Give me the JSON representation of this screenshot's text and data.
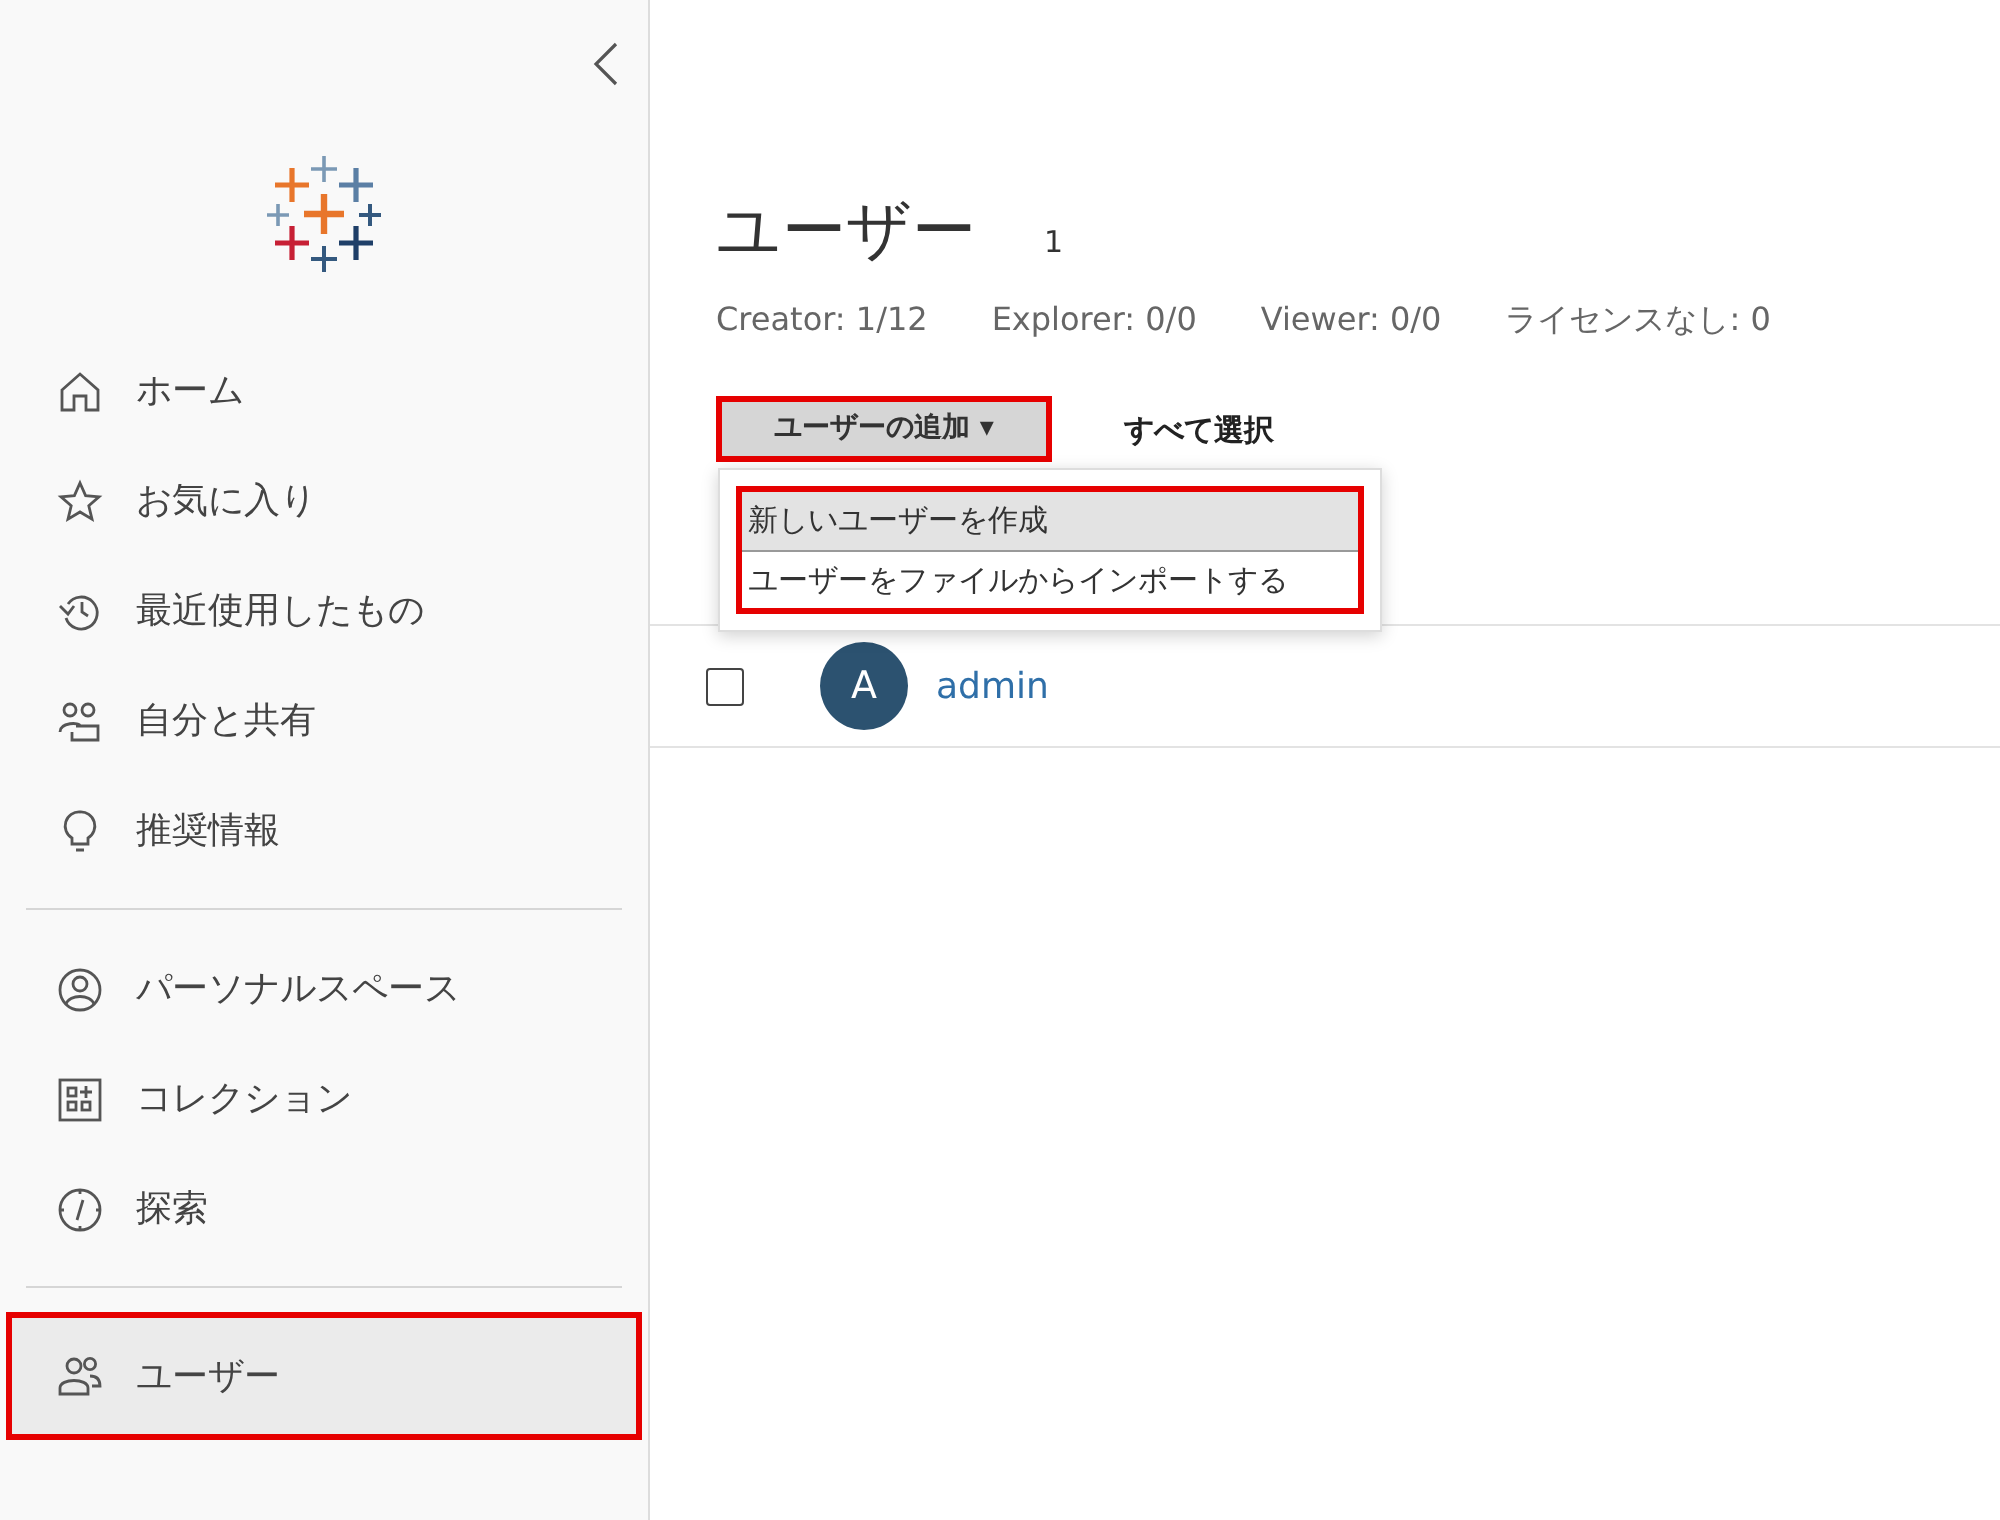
{
  "sidebar": {
    "groups": [
      {
        "items": [
          {
            "label": "ホーム",
            "selected": false,
            "annotated": false
          },
          {
            "label": "お気に入り",
            "selected": false,
            "annotated": false
          },
          {
            "label": "最近使用したもの",
            "selected": false,
            "annotated": false
          },
          {
            "label": "自分と共有",
            "selected": false,
            "annotated": false
          },
          {
            "label": "推奨情報",
            "selected": false,
            "annotated": false
          }
        ]
      },
      {
        "items": [
          {
            "label": "パーソナルスペース",
            "selected": false,
            "annotated": false
          },
          {
            "label": "コレクション",
            "selected": false,
            "annotated": false
          },
          {
            "label": "探索",
            "selected": false,
            "annotated": false
          }
        ]
      },
      {
        "items": [
          {
            "label": "ユーザー",
            "selected": true,
            "annotated": true
          }
        ]
      }
    ]
  },
  "page": {
    "title": "ユーザー",
    "count": "1",
    "licenses": [
      "Creator: 1/12",
      "Explorer: 0/0",
      "Viewer: 0/0",
      "ライセンスなし: 0"
    ],
    "add_button": {
      "label": "ユーザーの追加",
      "caret": "▾",
      "annotated": true
    },
    "select_all": "すべて選択",
    "menu": {
      "annotated": true,
      "items": [
        {
          "label": "新しいユーザーを作成",
          "selected": true
        },
        {
          "label": "ユーザーをファイルからインポートする",
          "selected": false
        }
      ]
    },
    "rows": [
      {
        "checked": false,
        "avatar": "A",
        "name": "admin"
      }
    ]
  }
}
